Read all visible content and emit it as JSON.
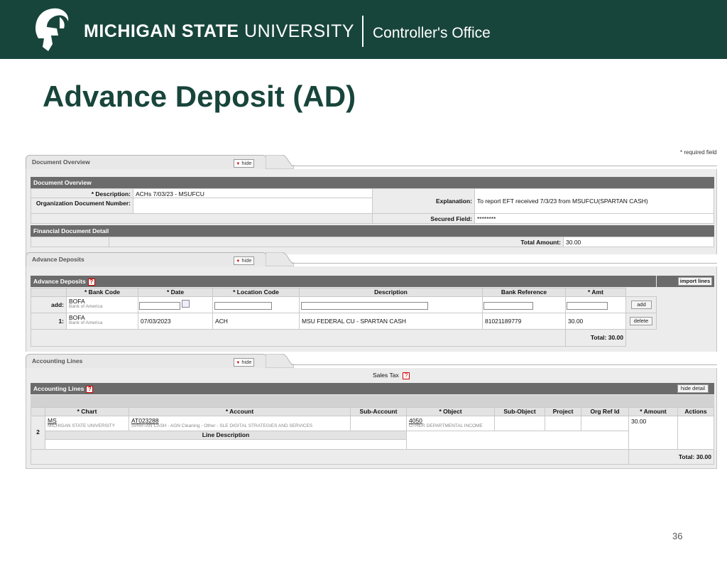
{
  "banner": {
    "brand_bold": "MICHIGAN STATE",
    "brand_light": "UNIVERSITY",
    "office": "Controller's Office"
  },
  "slide_title": "Advance Deposit (AD)",
  "page_number": "36",
  "required_note": "* required field",
  "doc_overview": {
    "tab_label": "Document Overview",
    "hide_label": "hide",
    "header": "Document Overview",
    "description_label": "* Description:",
    "description_value": "ACHs 7/03/23 - MSUFCU",
    "org_doc_label": "Organization Document Number:",
    "org_doc_value": "",
    "explanation_label": "Explanation:",
    "explanation_value": "To report EFT received 7/3/23 from MSUFCU(SPARTAN CASH)",
    "secured_label": "Secured Field:",
    "secured_value": "********",
    "fin_header": "Financial Document Detail",
    "total_label": "Total Amount:",
    "total_value": "30.00"
  },
  "advance_deposits": {
    "tab_label": "Advance Deposits",
    "hide_label": "hide",
    "header": "Advance Deposits",
    "import_label": "import lines",
    "columns": [
      "* Bank Code",
      "* Date",
      "* Location Code",
      "Description",
      "Bank Reference",
      "* Amt"
    ],
    "add_row_label": "add:",
    "add_bank_code": "BOFA",
    "add_bank_name": "Bank of America",
    "add_button": "add",
    "row": {
      "num": "1:",
      "bank_code": "BOFA",
      "bank_name": "Bank of America",
      "date": "07/03/2023",
      "location": "ACH",
      "description": "MSU FEDERAL CU - SPARTAN CASH",
      "bank_reference": "81021189779",
      "amount": "30.00",
      "delete_button": "delete"
    },
    "total": "Total: 30.00"
  },
  "accounting_lines": {
    "tab_label": "Accounting Lines",
    "hide_label": "hide",
    "sales_tax": "Sales Tax",
    "header": "Accounting Lines",
    "hide_detail": "hide detail",
    "columns": [
      "* Chart",
      "* Account",
      "Sub-Account",
      "* Object",
      "Sub-Object",
      "Project",
      "Org Ref Id",
      "* Amount",
      "Actions"
    ],
    "row": {
      "num": "2",
      "chart": "MS",
      "chart_name": "MICHIGAN STATE UNIVERSITY",
      "account": "AT023288",
      "account_name": "SPARTAN CASH - AGN Cleaning - Other - SLE DIGITAL STRATEGIES AND SERVICES",
      "object": "4050",
      "object_name": "OTHER DEPARTMENTAL INCOME",
      "amount": "30.00"
    },
    "line_description_label": "Line Description",
    "total": "Total: 30.00"
  }
}
